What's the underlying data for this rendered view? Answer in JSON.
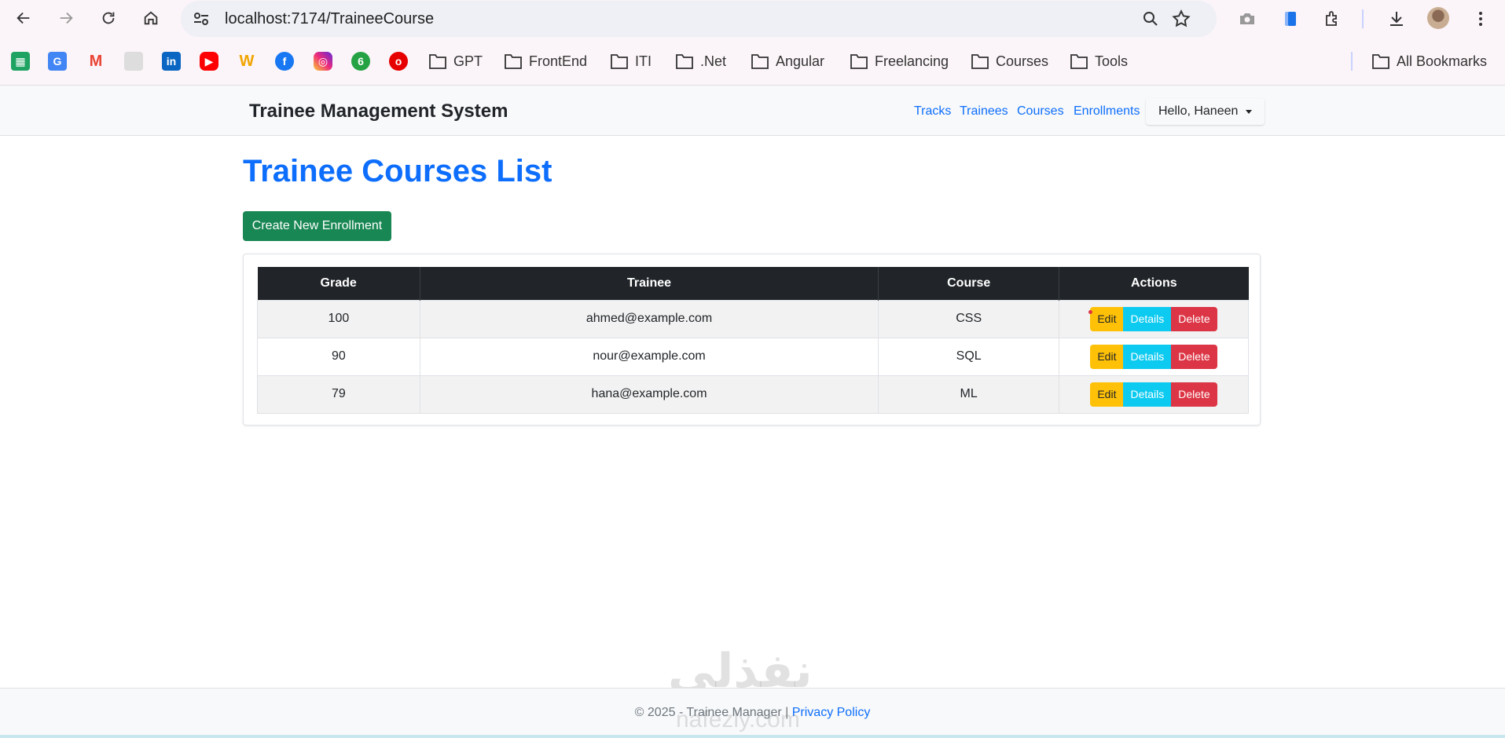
{
  "browser": {
    "url": "localhost:7174/TraineeCourse",
    "bookmarks": {
      "folders": [
        "GPT",
        "FrontEnd",
        "ITI",
        ".Net",
        "Angular",
        "Freelancing",
        "Courses",
        "Tools"
      ],
      "all_bookmarks": "All Bookmarks"
    },
    "icons": [
      "back-icon",
      "forward-icon",
      "reload-icon",
      "home-icon",
      "site-info-icon",
      "zoom-icon",
      "star-icon",
      "camera-icon",
      "tab-search-icon",
      "extensions-icon",
      "download-icon",
      "menu-icon"
    ]
  },
  "navbar": {
    "brand": "Trainee Management System",
    "links": [
      "Tracks",
      "Trainees",
      "Courses",
      "Enrollments"
    ],
    "user_menu": "Hello, Haneen"
  },
  "main": {
    "title": "Trainee Courses List",
    "create_button": "Create New Enrollment",
    "table": {
      "headers": [
        "Grade",
        "Trainee",
        "Course",
        "Actions"
      ],
      "rows": [
        {
          "grade": "100",
          "trainee": "ahmed@example.com",
          "course": "CSS"
        },
        {
          "grade": "90",
          "trainee": "nour@example.com",
          "course": "SQL"
        },
        {
          "grade": "79",
          "trainee": "hana@example.com",
          "course": "ML"
        }
      ],
      "actions": {
        "edit": "Edit",
        "details": "Details",
        "delete": "Delete"
      }
    }
  },
  "footer": {
    "text": "© 2025 - Trainee Manager |",
    "privacy_link": "Privacy Policy"
  },
  "watermark": {
    "arabic": "نفذلي",
    "url": "nafezly.com"
  },
  "colors": {
    "primary": "#0d6efd",
    "success": "#198754",
    "warning": "#ffc107",
    "info": "#0dcaf0",
    "danger": "#dc3545",
    "dark": "#212529"
  }
}
